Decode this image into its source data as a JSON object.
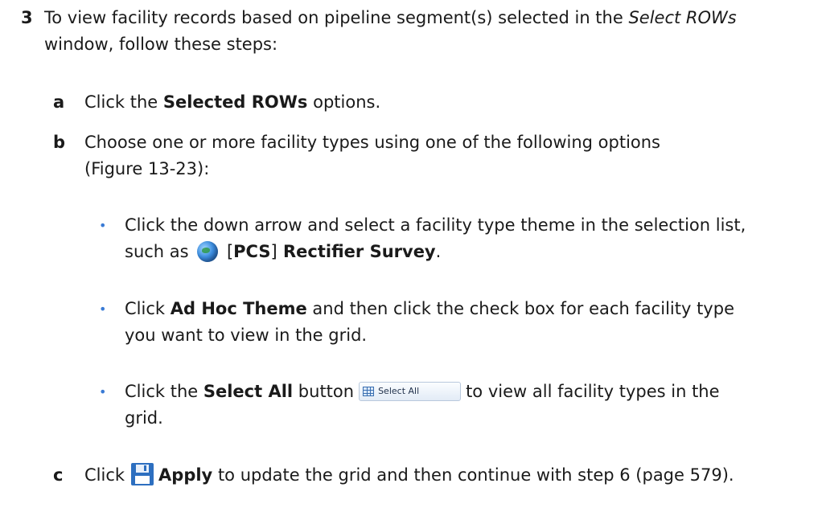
{
  "step3": {
    "number": "3",
    "line1_pre": "To view facility records based on pipeline segment(s) selected in the ",
    "line1_italic": "Select ROWs",
    "line2": "window, follow these steps:"
  },
  "step_a": {
    "letter": "a",
    "pre": "Click the ",
    "bold": "Selected ROWs",
    "post": " options."
  },
  "step_b": {
    "letter": "b",
    "line1": "Choose one or more facility types using one of the following options",
    "line2": "(Figure 13-23):"
  },
  "bullet1": {
    "line1": "Click the down arrow and select a facility type theme in the selection list,",
    "line2_pre": "such as ",
    "line2_bracket_open": " [",
    "line2_bold_a": "PCS",
    "line2_bracket_close": "]",
    "line2_bold_b": " Rectifier Survey",
    "line2_post": "."
  },
  "bullet2": {
    "line1_pre": "Click ",
    "line1_bold": "Ad Hoc Theme",
    "line1_post": " and then click the check box for each facility type",
    "line2": "you want to view in the grid."
  },
  "bullet3": {
    "line1_pre": "Click the ",
    "line1_bold": "Select All",
    "line1_mid": " button",
    "button_label": "Select All",
    "line1_post": "to view all facility types in the",
    "line2": "grid."
  },
  "step_c": {
    "letter": "c",
    "pre": "Click",
    "bold": "Apply",
    "post": " to update the grid and then continue with step 6 (page 579)."
  },
  "colors": {
    "bullet": "#3a7bd5",
    "text": "#1a1a1a"
  },
  "icons": [
    "globe-icon",
    "grid-icon",
    "save-icon"
  ]
}
